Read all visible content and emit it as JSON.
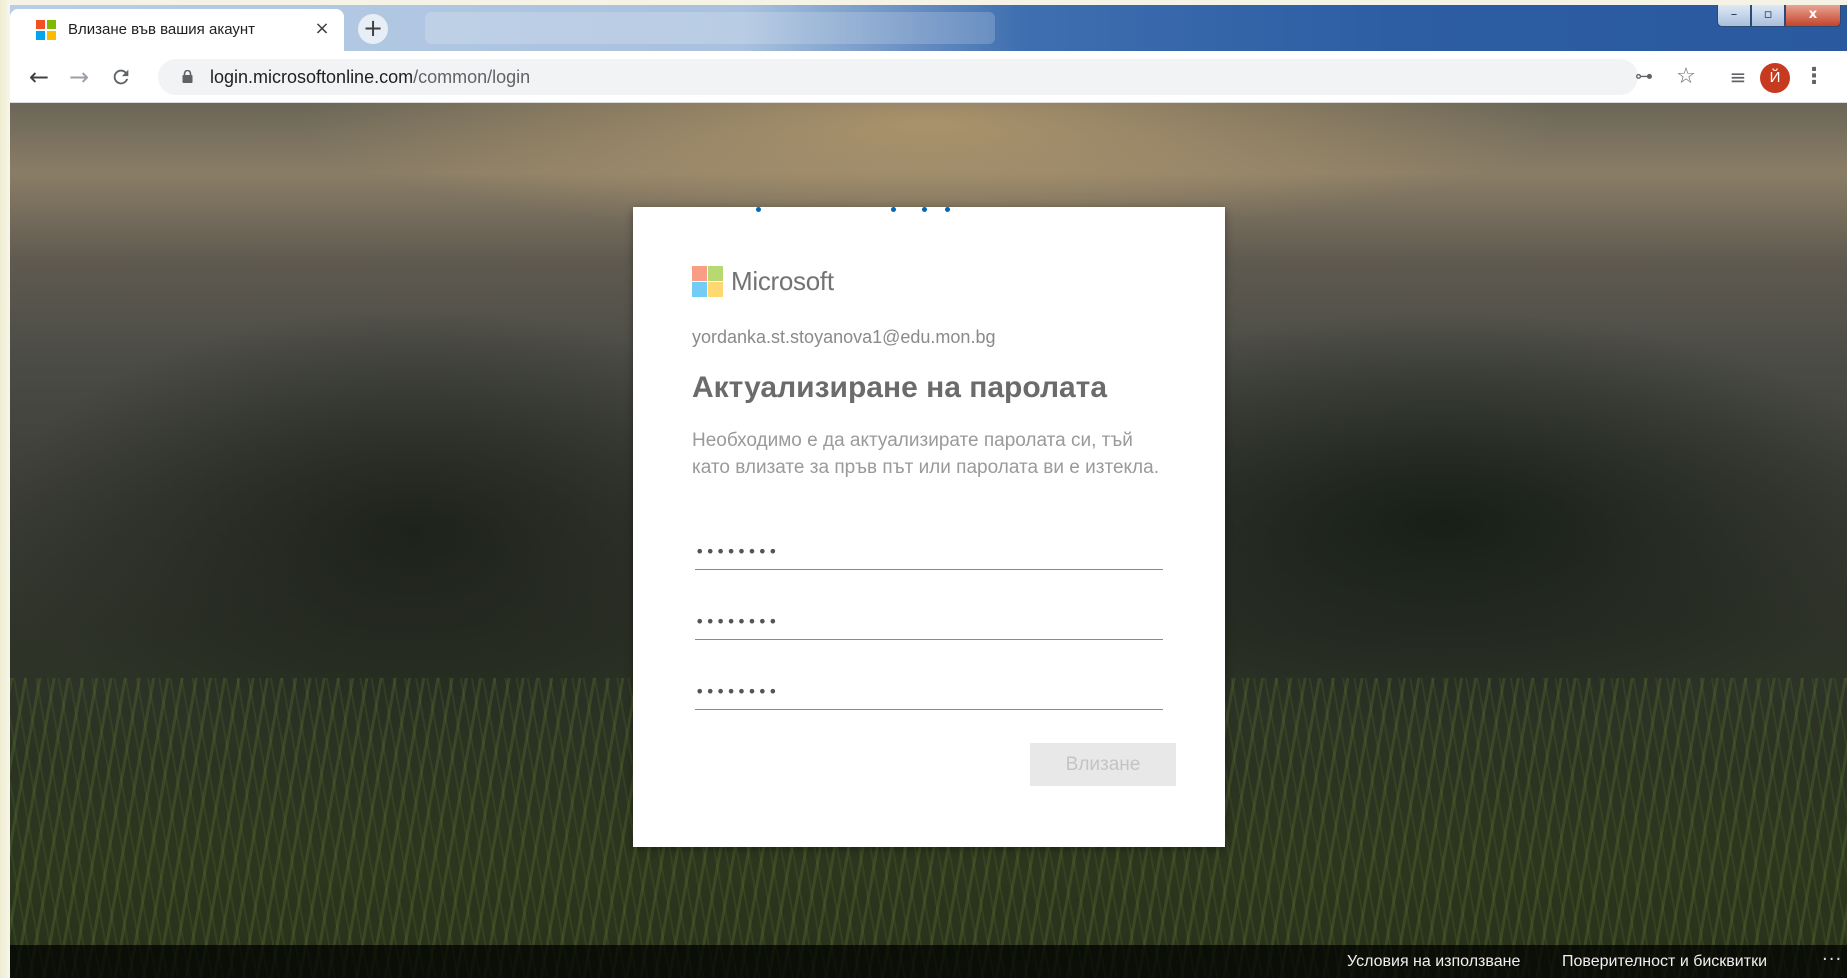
{
  "browser": {
    "tab": {
      "title": "Влизане във вашия акаунт",
      "close_icon": "×"
    },
    "new_tab_icon": "+",
    "window_controls": {
      "minimize": "–",
      "maximize": "▫",
      "close": "x"
    },
    "toolbar": {
      "back_icon": "←",
      "forward_icon": "→",
      "reload_icon": "C",
      "url_host": "login.microsoftonline.com",
      "url_path": "/common/login",
      "key_icon": "⊶",
      "star_icon": "☆",
      "media_icon": "≡",
      "profile_initial": "Й",
      "menu_icon": "⋮"
    }
  },
  "login": {
    "brand": "Microsoft",
    "email": "yordanka.st.stoyanova1@edu.mon.bg",
    "title": "Актуализиране на паролата",
    "description": "Необходимо е да актуализирате паролата си, тъй като влизате за пръв път или паролата ви е изтекла.",
    "current_password": "••••••••",
    "new_password": "••••••••",
    "confirm_password": "••••••••",
    "signin_label": "Влизане"
  },
  "footer": {
    "terms": "Условия на използване",
    "privacy": "Поверителност и бисквитки",
    "more": "···"
  },
  "colors": {
    "ms_red": "#f25022",
    "ms_green": "#7fba00",
    "ms_blue": "#00a4ef",
    "ms_yellow": "#ffb900",
    "progress_blue": "#0067b8"
  }
}
